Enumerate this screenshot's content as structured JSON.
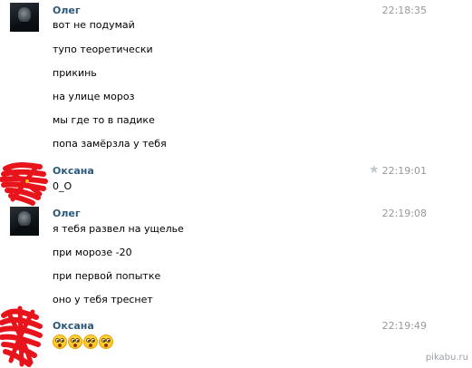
{
  "messages": [
    {
      "author": "Олег",
      "time": "22:18:35",
      "lines": [
        "вот не подумай",
        "тупо теоретически",
        "прикинь",
        "на улице мороз",
        "мы где то в падике",
        "попа замёрзла у тебя"
      ]
    },
    {
      "author": "Оксана",
      "time": "22:19:01",
      "lines": [
        "0_О"
      ],
      "star_icon": "star-icon"
    },
    {
      "author": "Олег",
      "time": "22:19:08",
      "lines": [
        "я тебя развел на ущелье",
        "при морозе -20",
        "при первой попытке",
        "оно у тебя треснет"
      ]
    },
    {
      "author": "Оксана",
      "time": "22:19:49",
      "emoji": [
        "flushed-face-icon",
        "flushed-face-icon",
        "flushed-face-icon",
        "flushed-face-icon"
      ]
    }
  ],
  "watermark": "pikabu.ru",
  "colors": {
    "author": "#2b587a",
    "time": "#999999",
    "scribble": "#e8141b"
  }
}
